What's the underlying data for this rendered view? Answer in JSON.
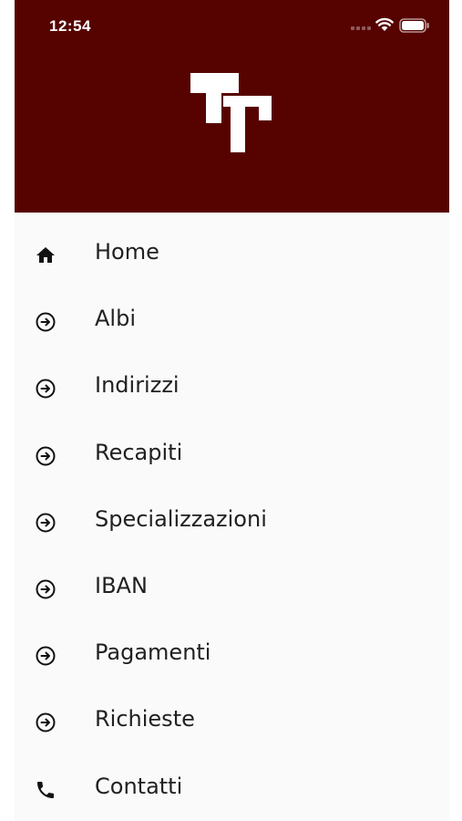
{
  "status_bar": {
    "time": "12:54",
    "icons": [
      "signal-icon",
      "wifi-icon",
      "battery-icon"
    ]
  },
  "header": {
    "background_color": "#560300",
    "logo": "brand-logo"
  },
  "menu": {
    "items": [
      {
        "label": "Home",
        "icon": "home-icon"
      },
      {
        "label": "Albi",
        "icon": "arrow-circle-right-icon"
      },
      {
        "label": "Indirizzi",
        "icon": "arrow-circle-right-icon"
      },
      {
        "label": "Recapiti",
        "icon": "arrow-circle-right-icon"
      },
      {
        "label": "Specializzazioni",
        "icon": "arrow-circle-right-icon"
      },
      {
        "label": "IBAN",
        "icon": "arrow-circle-right-icon"
      },
      {
        "label": "Pagamenti",
        "icon": "arrow-circle-right-icon"
      },
      {
        "label": "Richieste",
        "icon": "arrow-circle-right-icon"
      },
      {
        "label": "Contatti",
        "icon": "phone-icon"
      }
    ]
  }
}
